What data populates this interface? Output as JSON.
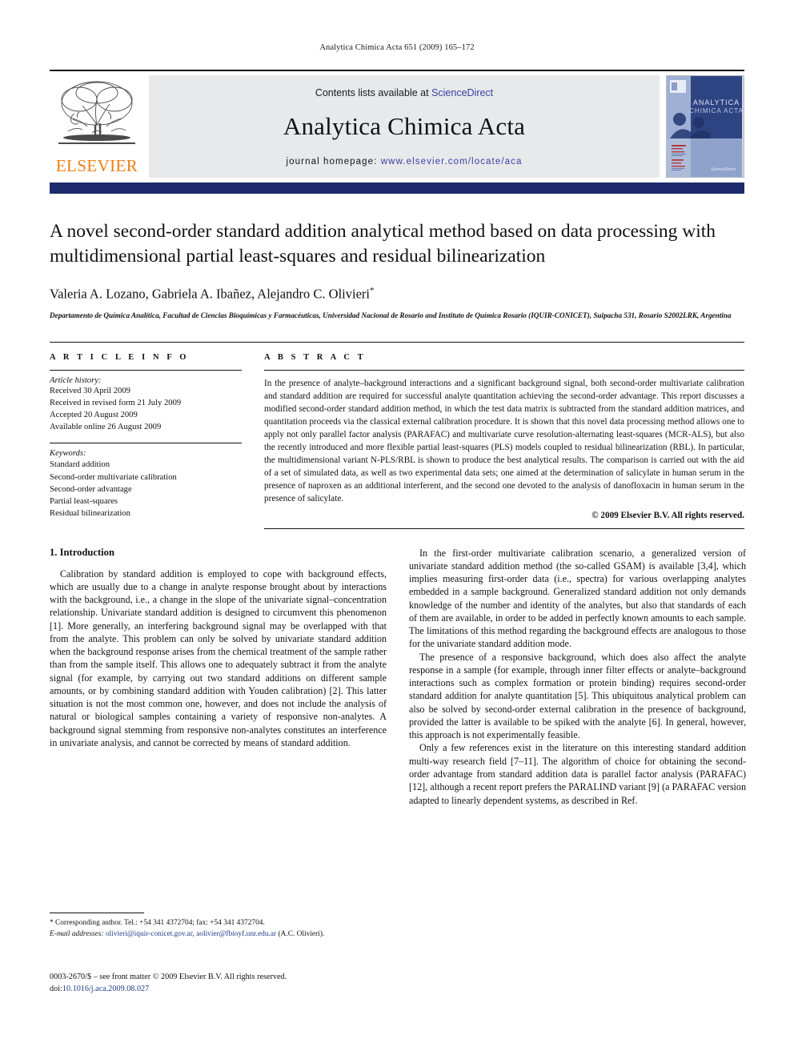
{
  "running_head": "Analytica Chimica Acta 651 (2009) 165–172",
  "masthead": {
    "publisher": "ELSEVIER",
    "contents_prefix": "Contents lists available at ",
    "sciencedirect": "ScienceDirect",
    "journal_title": "Analytica Chimica Acta",
    "homepage_label": "journal homepage:",
    "homepage_url": "www.elsevier.com/locate/aca",
    "cover_title_line1": "ANALYTICA",
    "cover_title_line2": "CHIMICA ACTA",
    "accent_orange": "#F07F13",
    "accent_blue": "#3a3fa0",
    "band_color": "#1d2a6b"
  },
  "title": "A novel second-order standard addition analytical method based on data processing with multidimensional partial least-squares and residual bilinearization",
  "authors": "Valeria A. Lozano, Gabriela A. Ibañez, Alejandro C. Olivieri",
  "author_marker": "*",
  "affiliation": "Departamento de Química Analítica, Facultad de Ciencias Bioquímicas y Farmacéuticas, Universidad Nacional de Rosario and Instituto de Química Rosario (IQUIR-CONICET), Suipacha 531, Rosario S2002LRK, Argentina",
  "article_info": {
    "heading": "A R T I C L E    I N F O",
    "history_label": "Article history:",
    "history": [
      "Received 30 April 2009",
      "Received in revised form 21 July 2009",
      "Accepted 20 August 2009",
      "Available online 26 August 2009"
    ],
    "keywords_label": "Keywords:",
    "keywords": [
      "Standard addition",
      "Second-order multivariate calibration",
      "Second-order advantage",
      "Partial least-squares",
      "Residual bilinearization"
    ]
  },
  "abstract": {
    "heading": "A B S T R A C T",
    "body": "In the presence of analyte–background interactions and a significant background signal, both second-order multivariate calibration and standard addition are required for successful analyte quantitation achieving the second-order advantage. This report discusses a modified second-order standard addition method, in which the test data matrix is subtracted from the standard addition matrices, and quantitation proceeds via the classical external calibration procedure. It is shown that this novel data processing method allows one to apply not only parallel factor analysis (PARAFAC) and multivariate curve resolution-alternating least-squares (MCR-ALS), but also the recently introduced and more flexible partial least-squares (PLS) models coupled to residual bilinearization (RBL). In particular, the multidimensional variant N-PLS/RBL is shown to produce the best analytical results. The comparison is carried out with the aid of a set of simulated data, as well as two experimental data sets; one aimed at the determination of salicylate in human serum in the presence of naproxen as an additional interferent, and the second one devoted to the analysis of danofloxacin in human serum in the presence of salicylate.",
    "copyright": "© 2009 Elsevier B.V. All rights reserved."
  },
  "sections": {
    "intro_number_title": "1.  Introduction",
    "left_paragraphs": [
      "Calibration by standard addition is employed to cope with background effects, which are usually due to a change in analyte response brought about by interactions with the background, i.e., a change in the slope of the univariate signal–concentration relationship. Univariate standard addition is designed to circumvent this phenomenon [1]. More generally, an interfering background signal may be overlapped with that from the analyte. This problem can only be solved by univariate standard addition when the background response arises from the chemical treatment of the sample rather than from the sample itself. This allows one to adequately subtract it from the analyte signal (for example, by carrying out two standard additions on different sample amounts, or by combining standard addition with Youden calibration) [2]. This latter situation is not the most common one, however, and does not include the analysis of natural or biological samples containing a variety of responsive non-analytes. A background signal stemming from responsive non-analytes constitutes an interference in univariate analysis, and cannot be corrected by means of standard addition."
    ],
    "right_paragraphs": [
      "In the first-order multivariate calibration scenario, a generalized version of univariate standard addition method (the so-called GSAM) is available [3,4], which implies measuring first-order data (i.e., spectra) for various overlapping analytes embedded in a sample background. Generalized standard addition not only demands knowledge of the number and identity of the analytes, but also that standards of each of them are available, in order to be added in perfectly known amounts to each sample. The limitations of this method regarding the background effects are analogous to those for the univariate standard addition mode.",
      "The presence of a responsive background, which does also affect the analyte response in a sample (for example, through inner filter effects or analyte–background interactions such as complex formation or protein binding) requires second-order standard addition for analyte quantitation [5]. This ubiquitous analytical problem can also be solved by second-order external calibration in the presence of background, provided the latter is available to be spiked with the analyte [6]. In general, however, this approach is not experimentally feasible.",
      "Only a few references exist in the literature on this interesting standard addition multi-way research field [7–11]. The algorithm of choice for obtaining the second-order advantage from standard addition data is parallel factor analysis (PARAFAC) [12], although a recent report prefers the PARALIND variant [9] (a PARAFAC version adapted to linearly dependent systems, as described in Ref."
    ]
  },
  "footnote": {
    "corresponding": "*  Corresponding author. Tel.: +54 341 4372704; fax: +54 341 4372704.",
    "email_label": "E-mail addresses:",
    "email1": "olivieri@iquir-conicet.gov.ar",
    "email_sep": ", ",
    "email2": "aolivier@fbioyf.unr.edu.ar",
    "email_suffix": " (A.C. Olivieri)."
  },
  "issn_block": {
    "line1": "0003-2670/$ – see front matter © 2009 Elsevier B.V. All rights reserved.",
    "doi_label": "doi:",
    "doi_value": "10.1016/j.aca.2009.08.027"
  }
}
